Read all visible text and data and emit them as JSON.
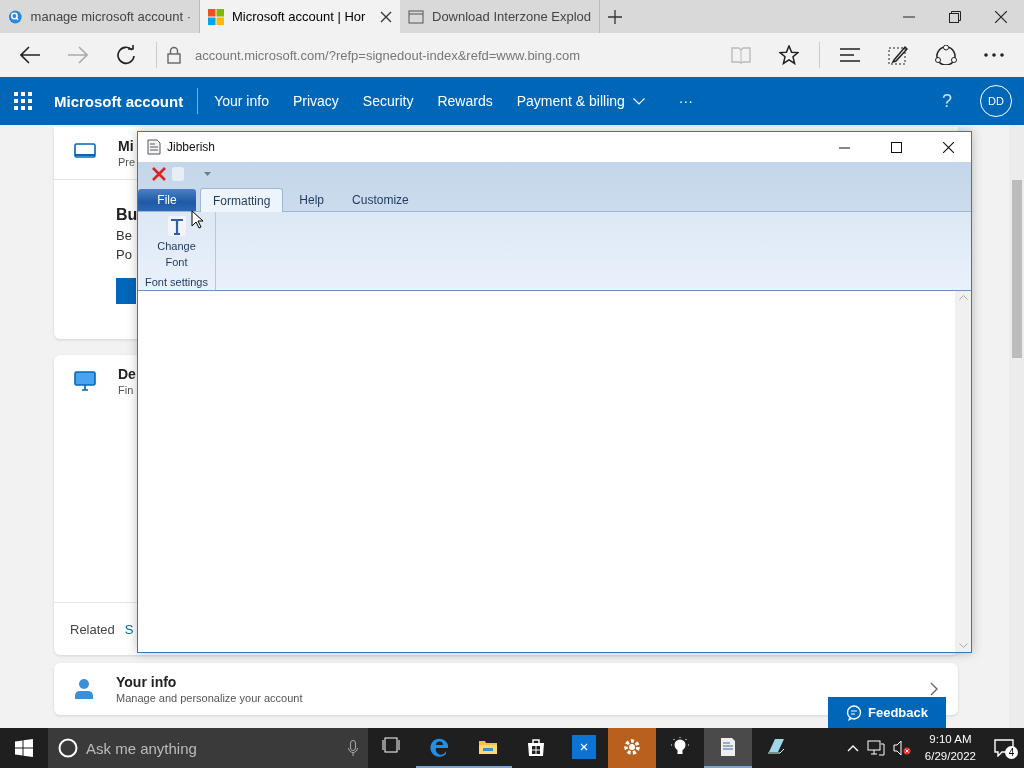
{
  "browser": {
    "tabs": [
      {
        "label": "manage microsoft account ·",
        "selected": false
      },
      {
        "label": "Microsoft account | Hor",
        "selected": true
      },
      {
        "label": "Download Interzone Explod",
        "selected": false
      }
    ],
    "url": "account.microsoft.com/?refp=signedout-index&refd=www.bing.com"
  },
  "site_nav": {
    "title": "Microsoft account",
    "items": [
      {
        "label": "Your info"
      },
      {
        "label": "Privacy"
      },
      {
        "label": "Security"
      },
      {
        "label": "Rewards"
      },
      {
        "label": "Payment & billing"
      }
    ],
    "more": "···",
    "help": "?",
    "avatar": "DD"
  },
  "page": {
    "cards": [
      {
        "title": "Mi",
        "subtitle": "Pre",
        "heading": "Bu",
        "lines": [
          "Be",
          "Po"
        ]
      },
      {
        "title": "De",
        "subtitle": "Fin",
        "related": "Related",
        "link": "S"
      },
      {
        "title": "Your info",
        "subtitle": "Manage and personalize your account"
      }
    ],
    "feedback": "Feedback"
  },
  "window": {
    "title": "Jibberish",
    "ribbon_tabs": [
      {
        "label": "File",
        "kind": "menu",
        "selected": false
      },
      {
        "label": "Formatting",
        "kind": "tab",
        "selected": true
      },
      {
        "label": "Help",
        "kind": "tab",
        "selected": false
      },
      {
        "label": "Customize",
        "kind": "tab",
        "selected": false
      }
    ],
    "group": {
      "button": "Change Font",
      "label": "Font settings"
    }
  },
  "taskbar": {
    "search": {
      "placeholder": "Ask me anything"
    },
    "time": "9:10 AM",
    "date": "6/29/2022",
    "notifications": "4"
  }
}
